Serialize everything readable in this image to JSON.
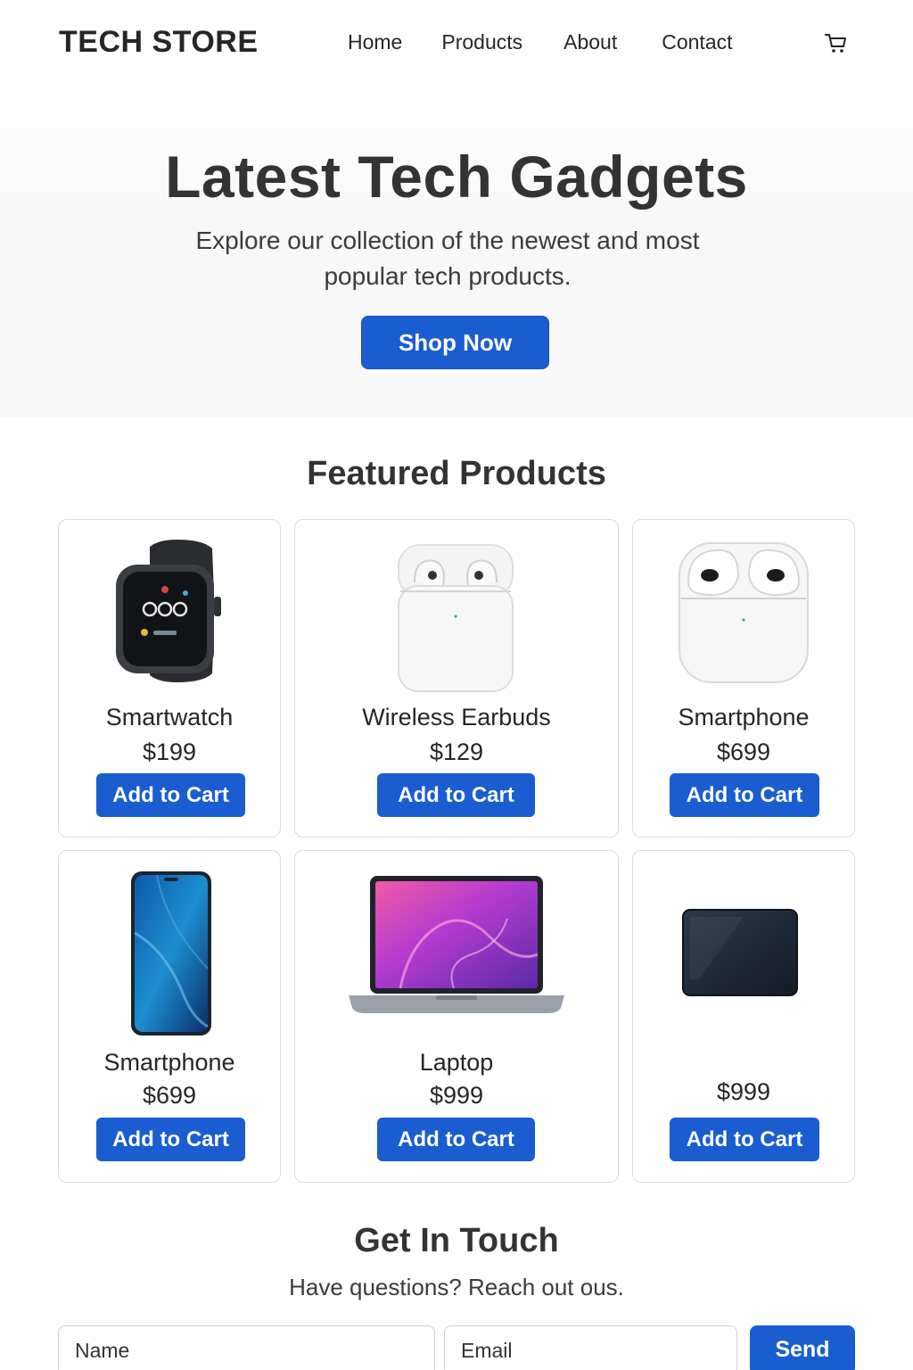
{
  "header": {
    "logo": "TECH STORE",
    "nav": [
      "Home",
      "Products",
      "About",
      "Contact"
    ],
    "cart_icon": "shopping-cart-icon"
  },
  "hero": {
    "title": "Latest Tech Gadgets",
    "subtitle": "Explore our collection of the newest and most popular tech products.",
    "cta": "Shop Now"
  },
  "featured": {
    "title": "Featured Products",
    "products": [
      {
        "name": "Smartwatch",
        "price": "$199",
        "button": "Add to Cart",
        "image": "smartwatch-image"
      },
      {
        "name": "Wireless Earbuds",
        "price": "$129",
        "button": "Add to Cart",
        "image": "earbuds-image"
      },
      {
        "name": "Smartphone",
        "price": "$699",
        "button": "Add to Cart",
        "image": "earbuds-case-image"
      },
      {
        "name": "Smartphone",
        "price": "$699",
        "button": "Add to Cart",
        "image": "smartphone-image"
      },
      {
        "name": "Laptop",
        "price": "$999",
        "button": "Add to Cart",
        "image": "laptop-image"
      },
      {
        "name": "",
        "price": "$999",
        "button": "Add to Cart",
        "image": "tablet-image"
      }
    ]
  },
  "contact": {
    "title": "Get In Touch",
    "subtitle": "Have questions? Reach out οus.",
    "name_placeholder": "Name",
    "email_placeholder": "Email",
    "send": "Send"
  },
  "colors": {
    "accent": "#1a5dd0",
    "text": "#262626",
    "border": "#dcdcdc"
  }
}
